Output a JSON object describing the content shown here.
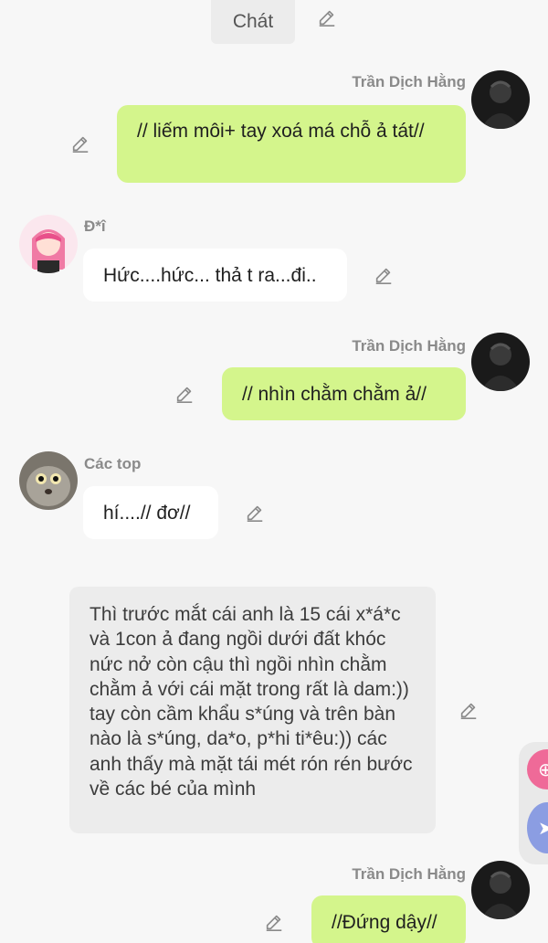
{
  "top_bar": {
    "label": "Chát"
  },
  "messages": [
    {
      "sender": "Trần Dịch Hằng",
      "text": "// liếm môi+ tay xoá má chỗ ả tát//"
    },
    {
      "sender": "Đ*î",
      "text": "Hức....hức... thả t ra...đi.."
    },
    {
      "sender": "Trần Dịch Hằng",
      "text": "// nhìn chằm chằm ả//"
    },
    {
      "sender": "Các top",
      "text": "hí....// đơ//"
    },
    {
      "sender": "",
      "text": "Thì trước mắt cái anh là 15 cái x*á*c và 1con ả đang ngồi dưới đất khóc nức nở còn cậu thì ngồi nhìn chằm chằm ả với cái mặt trong rất là dam:)) tay còn cầm khẩu s*úng và trên bàn nào là s*úng, da*o, p*hi ti*êu:)) các anh thấy mà mặt tái mét rón rén bước về các bé của mình"
    },
    {
      "sender": "Trần Dịch Hằng",
      "text": "//Đứng dậy//"
    }
  ],
  "colors": {
    "background": "#f7f7f7",
    "bubble_self": "#d4f58c",
    "bubble_other": "#ffffff",
    "bubble_narration": "#ececec",
    "float_pink": "#ef6a98",
    "float_blue": "#8b9de2"
  },
  "icons": {
    "edit": "pencil-icon",
    "float_top": "plus-icon",
    "float_bottom": "arrow-icon"
  }
}
